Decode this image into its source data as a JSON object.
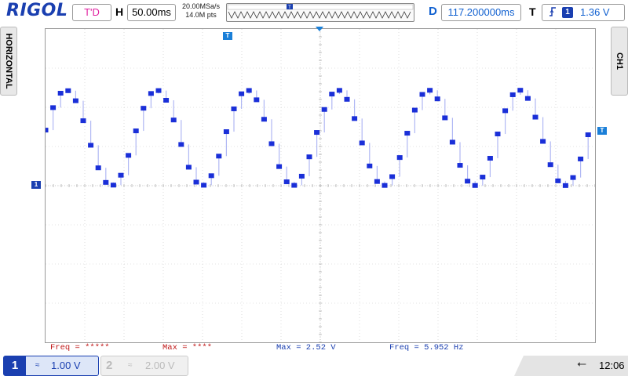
{
  "brand": {
    "logo": "RIGOL"
  },
  "top": {
    "run_state": "T'D",
    "horizontal_label": "H",
    "timebase": "50.00ms",
    "sample_rate": "20.00MSa/s",
    "memory_depth": "14.0M pts",
    "delay_label": "D",
    "delay": "117.200000ms",
    "trigger_label": "T",
    "trigger_source": "1",
    "trigger_level": "1.36 V"
  },
  "side": {
    "left_tab": "HORIZONTAL",
    "right_tab": "CH1"
  },
  "markers": {
    "trigger_pos": "T",
    "ch1_ground": "1",
    "trigger_level_marker": "T"
  },
  "measurements": [
    {
      "label": "Freq = *****",
      "color": "#c01818"
    },
    {
      "label": "Max = ****",
      "color": "#c01818"
    },
    {
      "label": "Max = 2.52 V",
      "color": "#1a3fb0"
    },
    {
      "label": "Freq = 5.952 Hz",
      "color": "#1a3fb0"
    }
  ],
  "channels": {
    "ch1": {
      "number": "1",
      "scale": "1.00 V",
      "coupling": "≈"
    },
    "ch2": {
      "number": "2",
      "scale": "2.00 V",
      "coupling": "≈"
    }
  },
  "status": {
    "usb_icon": "usb-icon",
    "clock": "12:06"
  },
  "colors": {
    "trace": "#1a2fd8",
    "accent": "#1a3fb0"
  }
}
